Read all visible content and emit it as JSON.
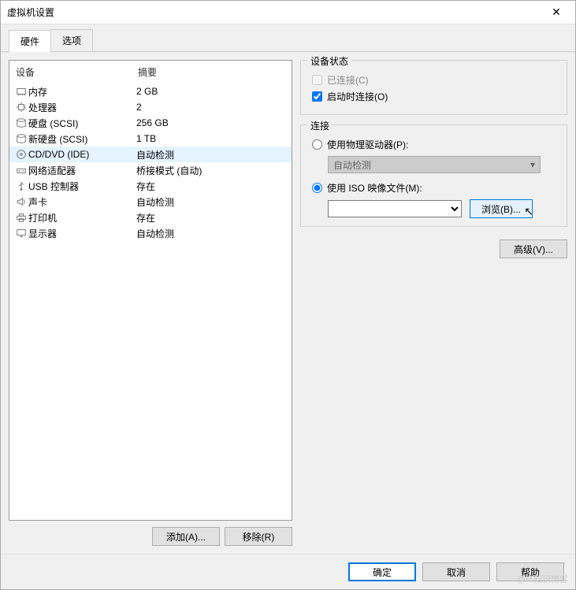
{
  "window": {
    "title": "虚拟机设置"
  },
  "tabs": {
    "hardware": "硬件",
    "options": "选项"
  },
  "list": {
    "header_device": "设备",
    "header_summary": "摘要",
    "rows": [
      {
        "icon": "memory-icon",
        "device": "内存",
        "summary": "2 GB"
      },
      {
        "icon": "cpu-icon",
        "device": "处理器",
        "summary": "2"
      },
      {
        "icon": "disk-icon",
        "device": "硬盘 (SCSI)",
        "summary": "256 GB"
      },
      {
        "icon": "disk-icon",
        "device": "新硬盘 (SCSI)",
        "summary": "1 TB"
      },
      {
        "icon": "cd-icon",
        "device": "CD/DVD (IDE)",
        "summary": "自动检测"
      },
      {
        "icon": "network-icon",
        "device": "网络适配器",
        "summary": "桥接模式 (自动)"
      },
      {
        "icon": "usb-icon",
        "device": "USB 控制器",
        "summary": "存在"
      },
      {
        "icon": "sound-icon",
        "device": "声卡",
        "summary": "自动检测"
      },
      {
        "icon": "printer-icon",
        "device": "打印机",
        "summary": "存在"
      },
      {
        "icon": "display-icon",
        "device": "显示器",
        "summary": "自动检测"
      }
    ],
    "selected_index": 4
  },
  "left_buttons": {
    "add": "添加(A)...",
    "remove": "移除(R)"
  },
  "device_status": {
    "title": "设备状态",
    "connected": "已连接(C)",
    "connect_at_poweron": "启动时连接(O)"
  },
  "connection": {
    "title": "连接",
    "use_physical": "使用物理驱动器(P):",
    "physical_value": "自动检测",
    "use_iso": "使用 ISO 映像文件(M):",
    "iso_value": "",
    "browse": "浏览(B)..."
  },
  "advanced": "高级(V)...",
  "footer": {
    "ok": "确定",
    "cancel": "取消",
    "help": "帮助"
  },
  "watermark": "@IT知识博客"
}
